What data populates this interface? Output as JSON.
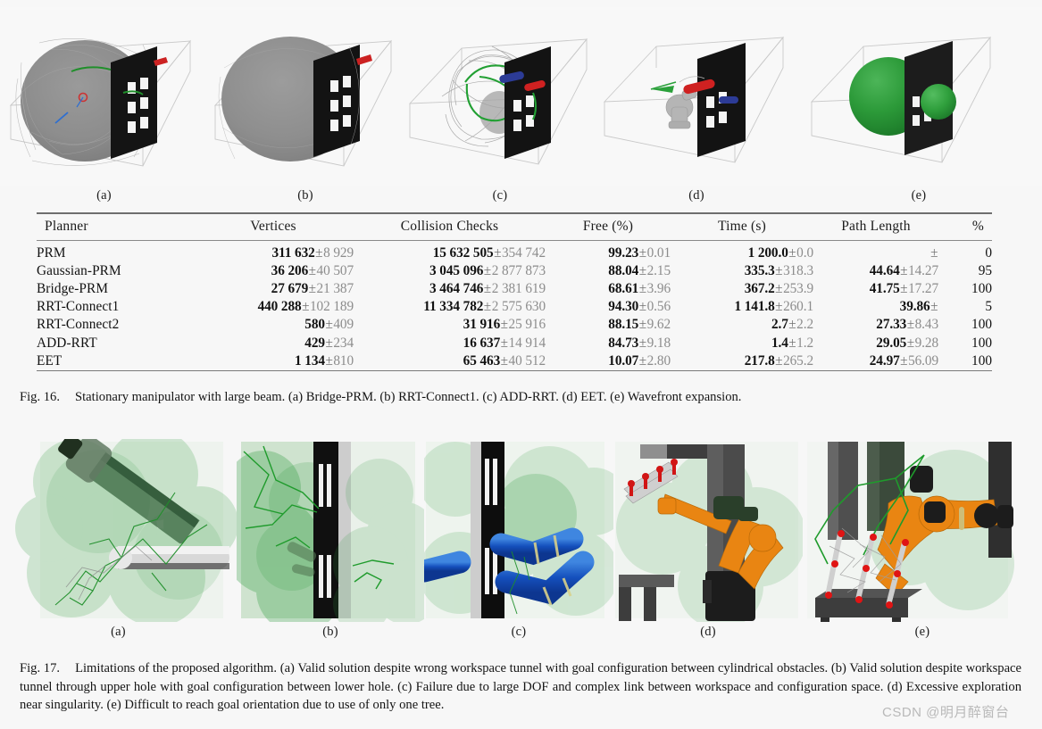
{
  "figure16": {
    "panels": [
      {
        "label": "(a)",
        "scene": "prm-dense-gray-blob"
      },
      {
        "label": "(b)",
        "scene": "solid-gray-blob"
      },
      {
        "label": "(c)",
        "scene": "sparse-green-tree"
      },
      {
        "label": "(d)",
        "scene": "manipulator-solution"
      },
      {
        "label": "(e)",
        "scene": "green-wavefront-spheres"
      }
    ],
    "caption_number": "Fig. 16.",
    "caption_text": "Stationary manipulator with large beam. (a) Bridge-PRM. (b) RRT-Connect1. (c) ADD-RRT. (d) EET. (e) Wavefront expansion."
  },
  "table": {
    "columns": [
      "Planner",
      "Vertices",
      "Collision Checks",
      "Free (%)",
      "Time (s)",
      "Path Length",
      "%"
    ],
    "rows": [
      {
        "planner": "PRM",
        "vertices": {
          "mean": "311 632",
          "std": "8 929"
        },
        "collision_checks": {
          "mean": "15 632 505",
          "std": "354 742"
        },
        "free": {
          "mean": "99.23",
          "std": "0.01"
        },
        "time": {
          "mean": "1 200.0",
          "std": "0.0"
        },
        "path_length": {
          "mean": "",
          "std": ""
        },
        "pct": "0"
      },
      {
        "planner": "Gaussian-PRM",
        "vertices": {
          "mean": "36 206",
          "std": "40 507"
        },
        "collision_checks": {
          "mean": "3 045 096",
          "std": "2 877 873"
        },
        "free": {
          "mean": "88.04",
          "std": "2.15"
        },
        "time": {
          "mean": "335.3",
          "std": "318.3"
        },
        "path_length": {
          "mean": "44.64",
          "std": "14.27"
        },
        "pct": "95"
      },
      {
        "planner": "Bridge-PRM",
        "vertices": {
          "mean": "27 679",
          "std": "21 387"
        },
        "collision_checks": {
          "mean": "3 464 746",
          "std": "2 381 619"
        },
        "free": {
          "mean": "68.61",
          "std": "3.96"
        },
        "time": {
          "mean": "367.2",
          "std": "253.9"
        },
        "path_length": {
          "mean": "41.75",
          "std": "17.27"
        },
        "pct": "100"
      },
      {
        "planner": "RRT-Connect1",
        "vertices": {
          "mean": "440 288",
          "std": "102 189"
        },
        "collision_checks": {
          "mean": "11 334 782",
          "std": "2 575 630"
        },
        "free": {
          "mean": "94.30",
          "std": "0.56"
        },
        "time": {
          "mean": "1 141.8",
          "std": "260.1"
        },
        "path_length": {
          "mean": "39.86",
          "std": ""
        },
        "pct": "5"
      },
      {
        "planner": "RRT-Connect2",
        "vertices": {
          "mean": "580",
          "std": "409"
        },
        "collision_checks": {
          "mean": "31 916",
          "std": "25 916"
        },
        "free": {
          "mean": "88.15",
          "std": "9.62"
        },
        "time": {
          "mean": "2.7",
          "std": "2.2"
        },
        "path_length": {
          "mean": "27.33",
          "std": "8.43"
        },
        "pct": "100"
      },
      {
        "planner": "ADD-RRT",
        "vertices": {
          "mean": "429",
          "std": "234"
        },
        "collision_checks": {
          "mean": "16 637",
          "std": "14 914"
        },
        "free": {
          "mean": "84.73",
          "std": "9.18"
        },
        "time": {
          "mean": "1.4",
          "std": "1.2"
        },
        "path_length": {
          "mean": "29.05",
          "std": "9.28"
        },
        "pct": "100"
      },
      {
        "planner": "EET",
        "vertices": {
          "mean": "1 134",
          "std": "810"
        },
        "collision_checks": {
          "mean": "65 463",
          "std": "40 512"
        },
        "free": {
          "mean": "10.07",
          "std": "2.80"
        },
        "time": {
          "mean": "217.8",
          "std": "265.2"
        },
        "path_length": {
          "mean": "24.97",
          "std": "56.09"
        },
        "pct": "100"
      }
    ]
  },
  "figure17": {
    "panels": [
      {
        "label": "(a)",
        "scene": "green-spheres-arm-cylinder"
      },
      {
        "label": "(b)",
        "scene": "green-spheres-wall-slots"
      },
      {
        "label": "(c)",
        "scene": "blue-snake-robot-wall"
      },
      {
        "label": "(d)",
        "scene": "orange-robot-singularity"
      },
      {
        "label": "(e)",
        "scene": "orange-robot-one-tree"
      }
    ],
    "caption_number": "Fig. 17.",
    "caption_text": "Limitations of the proposed algorithm. (a) Valid solution despite wrong workspace tunnel with goal configuration between cylindrical obstacles. (b) Valid solution despite workspace tunnel through upper hole with goal configuration between lower hole. (c) Failure due to large DOF and complex link between workspace and configuration space. (d) Excessive exploration near singularity. (e) Difficult to reach goal orientation due to use of only one tree."
  },
  "watermark": {
    "text": "CSDN @明月醉窗台"
  },
  "colors": {
    "page_background": "#f7f7f7",
    "rule": "#6e6e6e",
    "mean_text": "#111111",
    "std_text": "#8c8c8c",
    "green_sphere": "#2e9b3c",
    "robot_orange": "#e98512",
    "snake_blue": "#1a56c4",
    "wall_dark": "#141414",
    "watermark": "#b9b9b9"
  }
}
